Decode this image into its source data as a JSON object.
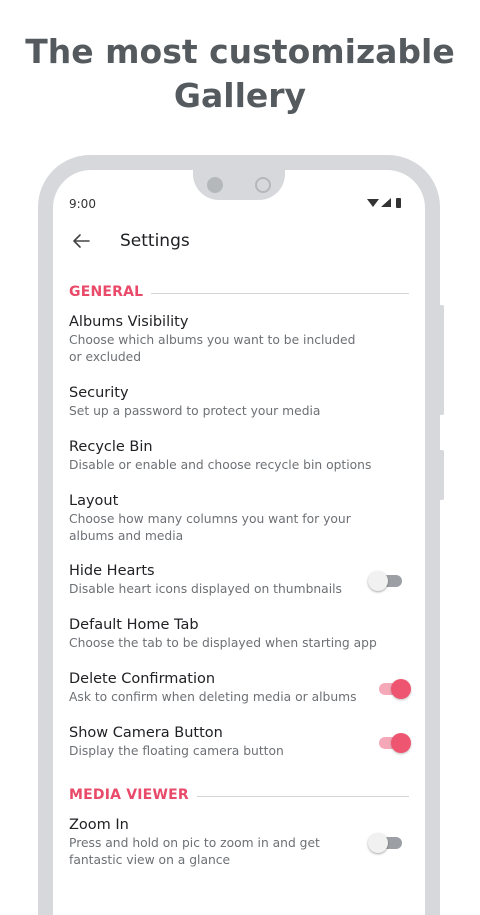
{
  "headline": {
    "line1": "The most customizable",
    "line2": "Gallery"
  },
  "status_bar": {
    "time": "9:00"
  },
  "app_bar": {
    "title": "Settings"
  },
  "sections": {
    "general": {
      "title": "GENERAL"
    },
    "media_viewer": {
      "title": "MEDIA VIEWER"
    }
  },
  "settings": [
    {
      "title": "Albums Visibility",
      "subtitle": "Choose which albums you want to be included or excluded"
    },
    {
      "title": "Security",
      "subtitle": "Set up a password to protect your media"
    },
    {
      "title": "Recycle Bin",
      "subtitle": "Disable or enable and choose recycle bin options"
    },
    {
      "title": "Layout",
      "subtitle": "Choose how many columns you want for your albums and media"
    },
    {
      "title": "Hide Hearts",
      "subtitle": "Disable heart icons displayed on thumbnails",
      "toggle": false
    },
    {
      "title": "Default Home Tab",
      "subtitle": "Choose the tab to be displayed when starting app"
    },
    {
      "title": "Delete Confirmation",
      "subtitle": "Ask to confirm when deleting media or albums",
      "toggle": true
    },
    {
      "title": "Show Camera Button",
      "subtitle": "Display the floating camera button",
      "toggle": true
    },
    {
      "title": "Zoom In",
      "subtitle": "Press and hold on pic to zoom in and get fantastic view on a glance",
      "toggle": false
    }
  ],
  "colors": {
    "accent": "#e94a69",
    "frame": "#d6d8db",
    "headline": "#555a5e"
  },
  "icons": {
    "back": "arrow-back-icon",
    "wifi": "wifi-icon",
    "signal": "signal-icon",
    "battery": "battery-icon"
  }
}
